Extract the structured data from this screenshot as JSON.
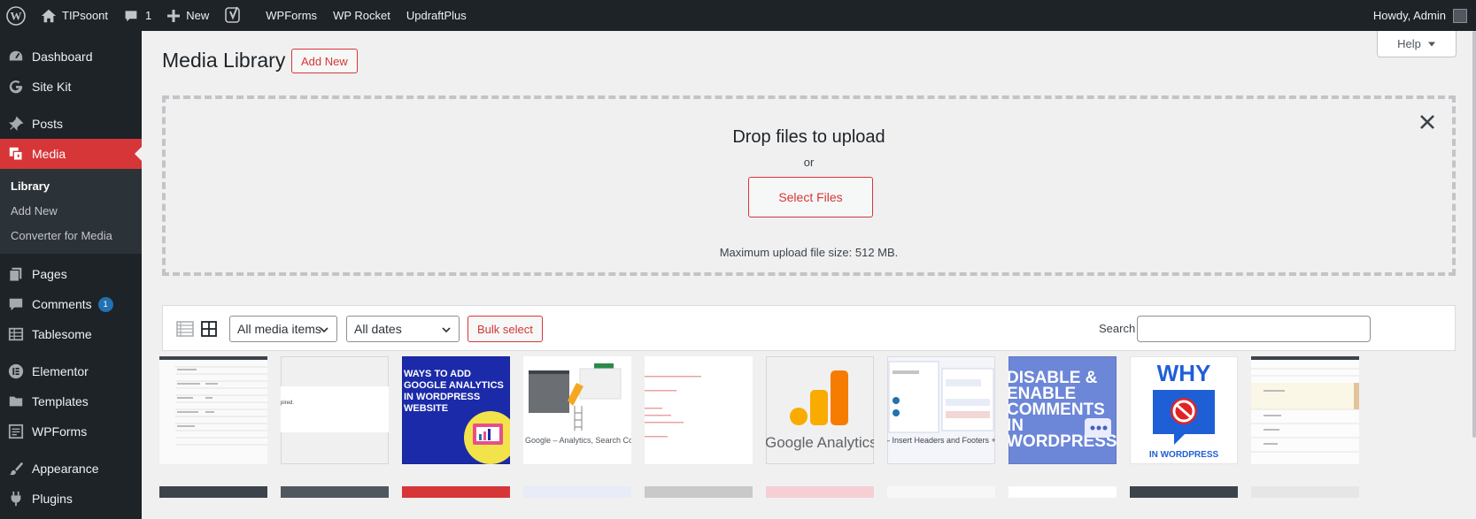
{
  "adminbar": {
    "site_name": "TIPsoont",
    "comments_count": "1",
    "new_label": "New",
    "items": [
      "WPForms",
      "WP Rocket",
      "UpdraftPlus"
    ],
    "howdy": "Howdy, Admin"
  },
  "sidebar": {
    "items": [
      {
        "label": "Dashboard",
        "icon": "dashboard-icon"
      },
      {
        "label": "Site Kit",
        "icon": "google-g-icon"
      },
      {
        "label": "Posts",
        "icon": "pin-icon"
      },
      {
        "label": "Media",
        "icon": "media-icon",
        "active": true
      },
      {
        "label": "Pages",
        "icon": "pages-icon"
      },
      {
        "label": "Comments",
        "icon": "comment-icon",
        "badge": "1"
      },
      {
        "label": "Tablesome",
        "icon": "table-icon"
      },
      {
        "label": "Elementor",
        "icon": "elementor-icon"
      },
      {
        "label": "Templates",
        "icon": "folder-icon"
      },
      {
        "label": "WPForms",
        "icon": "form-icon"
      },
      {
        "label": "Appearance",
        "icon": "brush-icon"
      },
      {
        "label": "Plugins",
        "icon": "plug-icon"
      }
    ],
    "media_sub": [
      "Library",
      "Add New",
      "Converter for Media"
    ]
  },
  "main": {
    "help_label": "Help",
    "title": "Media Library",
    "add_new_label": "Add New",
    "uploader": {
      "drop_title": "Drop files to upload",
      "or": "or",
      "select_files": "Select Files",
      "max_size": "Maximum upload file size: 512 MB."
    },
    "toolbar": {
      "type_filter": "All media items",
      "date_filter": "All dates",
      "bulk_select": "Bulk select",
      "search_label": "Search",
      "search_value": ""
    },
    "thumbnails": [
      {
        "kind": "table-screenshot"
      },
      {
        "kind": "text-crop",
        "text": "pired."
      },
      {
        "kind": "banner",
        "text": "WAYS TO ADD GOOGLE ANALYTICS IN WORDPRESS WEBSITE"
      },
      {
        "kind": "illustration",
        "text": "Google – Analytics, Search Console, Speed"
      },
      {
        "kind": "text-screenshot"
      },
      {
        "kind": "logo",
        "text": "Google Analytics"
      },
      {
        "kind": "plugin-screenshot",
        "text": "– Insert Headers and Footers + Custom Snippets – WordPress Code Manager"
      },
      {
        "kind": "banner-blue",
        "text": "DISABLE & ENABLE COMMENTS IN WORDPRESS"
      },
      {
        "kind": "why-logo",
        "text": "WHY",
        "sub": "IN WORDPRESS"
      },
      {
        "kind": "form-screenshot"
      }
    ],
    "colors": {
      "accent": "#d63638",
      "dark": "#1d2327",
      "blue": "#2271b1"
    }
  }
}
